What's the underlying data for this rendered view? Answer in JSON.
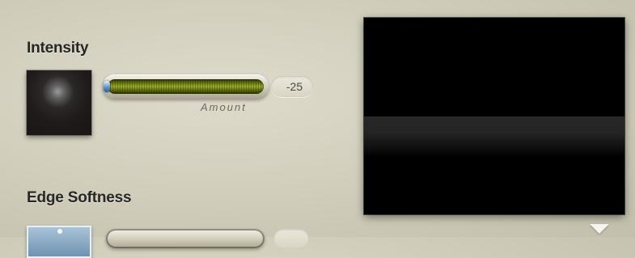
{
  "intensity": {
    "title": "Intensity",
    "slider": {
      "caption": "Amount",
      "value": "-25"
    }
  },
  "edge_softness": {
    "title": "Edge Softness"
  },
  "preview": {
    "background": "#000000",
    "menu_icon": "triangle-down-icon"
  }
}
